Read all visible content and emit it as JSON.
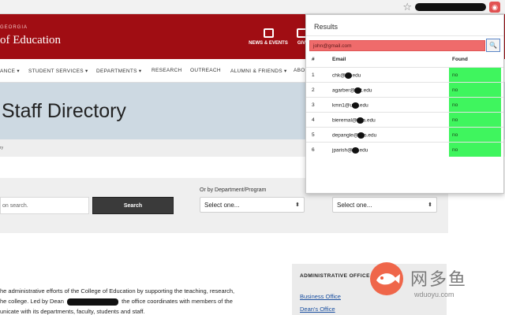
{
  "header": {
    "brand_top": "GEORGIA",
    "brand_text": "of Education",
    "quick_links": [
      {
        "label": "NEWS & EVENTS",
        "icon": "calendar-icon"
      },
      {
        "label": "GIV",
        "icon": "gift-icon"
      }
    ]
  },
  "nav": {
    "items": [
      "ANCE",
      "STUDENT SERVICES",
      "DEPARTMENTS",
      "RESEARCH",
      "OUTREACH",
      "ALUMNI & FRIENDS",
      "ABO"
    ]
  },
  "hero": {
    "title": "Staff Directory"
  },
  "breadcrumb": {
    "text": "ry"
  },
  "search": {
    "input_placeholder": "on search.",
    "button_label": "Search",
    "dept_label": "Or by Department/Program",
    "select_one": "Select one...",
    "select_two": "Select one..."
  },
  "body_copy": {
    "line1": "he administrative efforts of the College of Education by supporting the teaching, research,",
    "line2a": "he college. Led by Dean",
    "line2b": "the office coordinates with members of the",
    "line3": "unicate with its departments, faculty, students and staff."
  },
  "admin": {
    "title": "ADMINISTRATIVE OFFICE",
    "links": [
      "Business Office",
      "Dean's Office"
    ]
  },
  "popup": {
    "title": "Results",
    "query_value": "john@gmail.com",
    "search_icon_label": "🔍",
    "columns": [
      "#",
      "Email",
      "Found"
    ],
    "rows": [
      {
        "n": "1",
        "pre": "chk@",
        "post": ".edu",
        "found": "no"
      },
      {
        "n": "2",
        "pre": "agarber@",
        "post": "t.edu",
        "found": "no"
      },
      {
        "n": "3",
        "pre": "kmn1@u",
        "post": ".edu",
        "found": "no"
      },
      {
        "n": "4",
        "pre": "bieremal@",
        "post": "a.edu",
        "found": "no"
      },
      {
        "n": "5",
        "pre": "depangle@",
        "post": "s.edu",
        "found": "no"
      },
      {
        "n": "6",
        "pre": "jparish@",
        "post": ".edu",
        "found": "no"
      }
    ]
  },
  "watermark": {
    "text": "网多鱼",
    "url": "wduoyu.com"
  },
  "colors": {
    "brand_red": "#a00d13",
    "found_green": "#3ff55e",
    "query_red": "#ef6b6b"
  }
}
